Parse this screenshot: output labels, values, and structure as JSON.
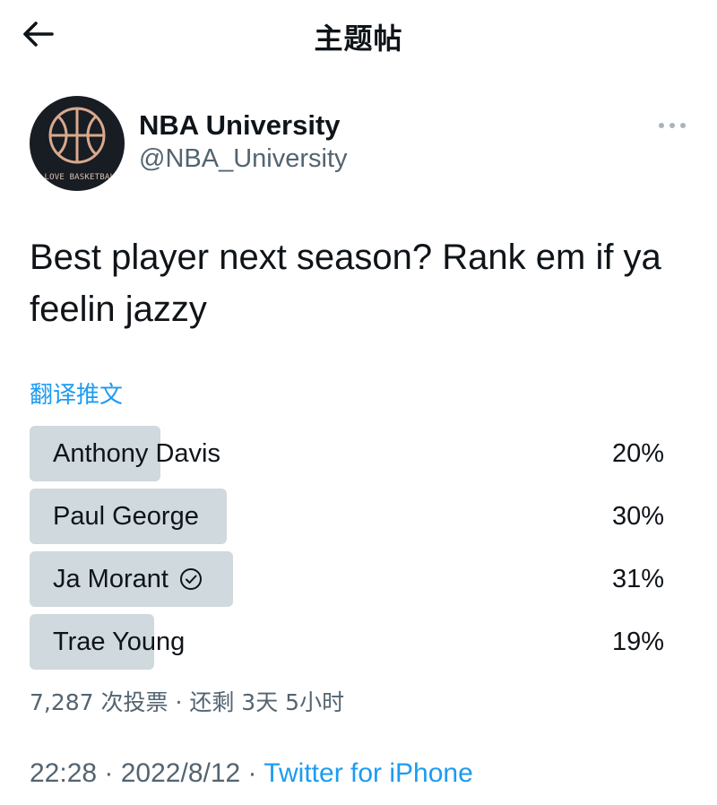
{
  "header": {
    "title": "主题帖"
  },
  "author": {
    "name": "NBA University",
    "handle": "@NBA_University",
    "avatar_text": "I LOVE BASKETBALL"
  },
  "tweet": {
    "text": "Best player next season? Rank em if ya feelin jazzy",
    "translate_label": "翻译推文"
  },
  "poll": {
    "options": [
      {
        "label": "Anthony Davis",
        "percent_text": "20%",
        "percent": 20,
        "selected": false
      },
      {
        "label": "Paul George",
        "percent_text": "30%",
        "percent": 30,
        "selected": false
      },
      {
        "label": "Ja Morant",
        "percent_text": "31%",
        "percent": 31,
        "selected": true
      },
      {
        "label": "Trae Young",
        "percent_text": "19%",
        "percent": 19,
        "selected": false
      }
    ],
    "meta": "7,287 次投票 · 还剩 3天 5小时"
  },
  "footer": {
    "time": "22:28",
    "sep1": " · ",
    "date": "2022/8/12",
    "sep2": " · ",
    "source": "Twitter for iPhone"
  },
  "colors": {
    "accent": "#1d9bf0",
    "poll_fill": "#cfd9de",
    "secondary_text": "#536471",
    "avatar_bg": "#181c23",
    "avatar_line": "#d8a98d"
  },
  "icons": {
    "back": "arrow-left-icon",
    "more": "more-horizontal-icon",
    "selected": "check-circle-icon",
    "avatar": "basketball-icon"
  }
}
